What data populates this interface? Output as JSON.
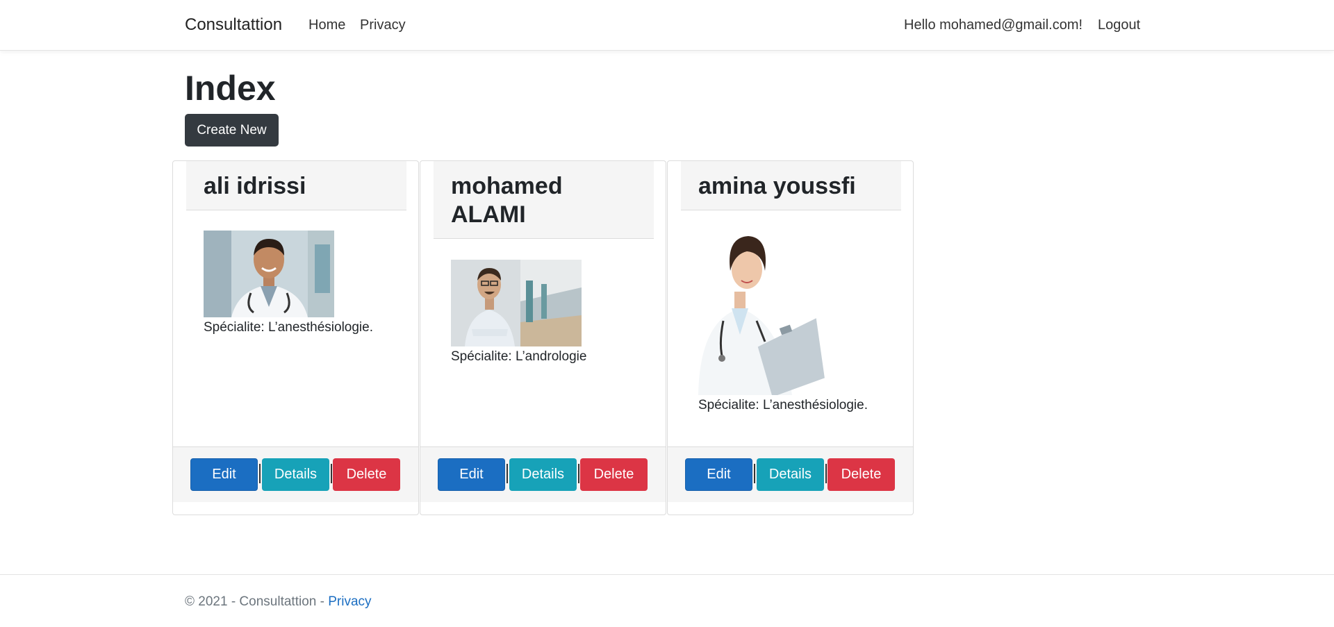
{
  "navbar": {
    "brand": "Consultattion",
    "links": [
      "Home",
      "Privacy"
    ],
    "greeting": "Hello mohamed@gmail.com!",
    "logout": "Logout"
  },
  "page": {
    "title": "Index",
    "create_button": "Create New"
  },
  "doctors": [
    {
      "name": "ali idrissi",
      "speciality": "Spécialite: L’anesthésiologie.",
      "edit": "Edit",
      "details": "Details",
      "delete": "Delete"
    },
    {
      "name": "mohamed ALAMI",
      "speciality": "Spécialite: L’andrologie",
      "edit": "Edit",
      "details": "Details",
      "delete": "Delete"
    },
    {
      "name": "amina youssfi",
      "speciality": "Spécialite: L’anesthésiologie.",
      "edit": "Edit",
      "details": "Details",
      "delete": "Delete"
    }
  ],
  "footer": {
    "text": "© 2021 - Consultattion - ",
    "privacy_link": "Privacy"
  },
  "colors": {
    "edit": "#1b6ec2",
    "details": "#17a2b8",
    "delete": "#dc3545",
    "create": "#343a40"
  }
}
